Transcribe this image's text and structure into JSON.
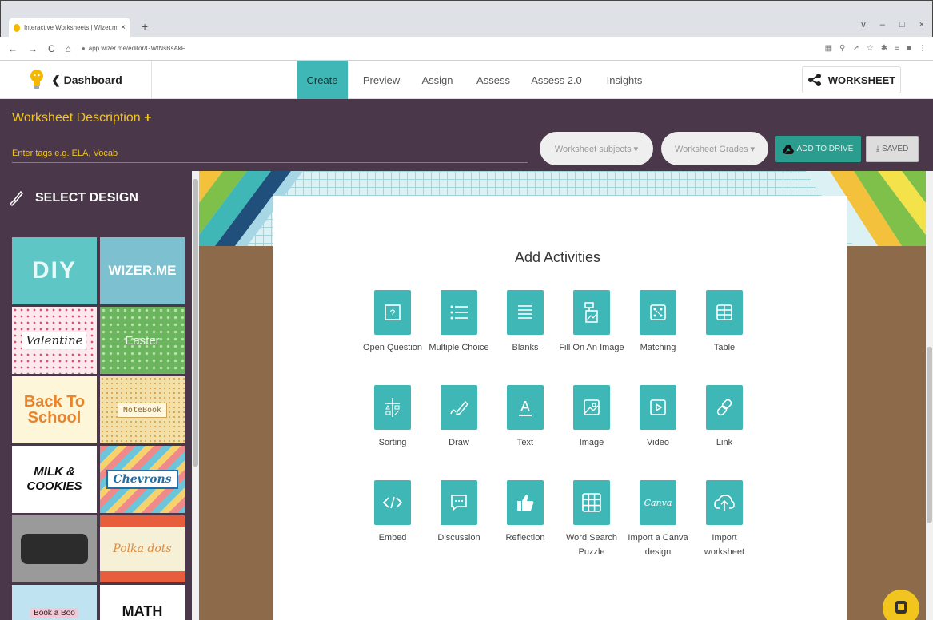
{
  "browser": {
    "tab_title": "Interactive Worksheets | Wizer.me",
    "tab_close": "×",
    "new_tab": "+",
    "url": "app.wizer.me/editor/GWfNsBsAkF",
    "nav": [
      "←",
      "→",
      "C",
      "⌂"
    ],
    "window_controls": [
      "v",
      "–",
      "□",
      "×"
    ]
  },
  "appnav": {
    "back_label": "Dashboard",
    "tabs": [
      "Create",
      "Preview",
      "Assign",
      "Assess",
      "Assess 2.0",
      "Insights"
    ],
    "active_tab": "Create",
    "worksheet_button": "WORKSHEET"
  },
  "header": {
    "description_label": "Worksheet Description",
    "description_plus": "+",
    "tags_placeholder": "Enter tags e.g. ELA, Vocab",
    "subjects_dropdown": "Worksheet subjects ▾",
    "grades_dropdown": "Worksheet Grades ▾",
    "add_to_drive": "ADD TO DRIVE",
    "saved": "SAVED"
  },
  "sidebar": {
    "title": "SELECT DESIGN",
    "designs": [
      "DIY",
      "WIZER.ME",
      "Valentine",
      "Easter",
      "Back To School",
      "NoteBook",
      "MILK & COOKIES",
      "Chevrons",
      "",
      "Polka dots",
      "Book a Boo",
      "MATH"
    ]
  },
  "main": {
    "title": "Add Activities",
    "activities": [
      {
        "label": "Open Question",
        "icon": "question-box-icon"
      },
      {
        "label": "Multiple Choice",
        "icon": "list-icon"
      },
      {
        "label": "Blanks",
        "icon": "blanks-icon"
      },
      {
        "label": "Fill On An Image",
        "icon": "fill-image-icon"
      },
      {
        "label": "Matching",
        "icon": "matching-icon"
      },
      {
        "label": "Table",
        "icon": "table-icon"
      },
      {
        "label": "Sorting",
        "icon": "sorting-icon"
      },
      {
        "label": "Draw",
        "icon": "pencil-icon"
      },
      {
        "label": "Text",
        "icon": "text-icon"
      },
      {
        "label": "Image",
        "icon": "image-icon"
      },
      {
        "label": "Video",
        "icon": "play-icon"
      },
      {
        "label": "Link",
        "icon": "link-icon"
      },
      {
        "label": "Embed",
        "icon": "code-icon"
      },
      {
        "label": "Discussion",
        "icon": "chat-icon"
      },
      {
        "label": "Reflection",
        "icon": "thumbs-up-icon"
      },
      {
        "label": "Word Search Puzzle",
        "icon": "grid-icon"
      },
      {
        "label": "Import a Canva design",
        "icon": "canva-icon",
        "icon_text": "Canva"
      },
      {
        "label": "Import worksheet",
        "icon": "upload-cloud-icon"
      }
    ]
  },
  "colors": {
    "purple": "#4a3749",
    "teal": "#3fb7b6",
    "yellow": "#f2c51e"
  }
}
